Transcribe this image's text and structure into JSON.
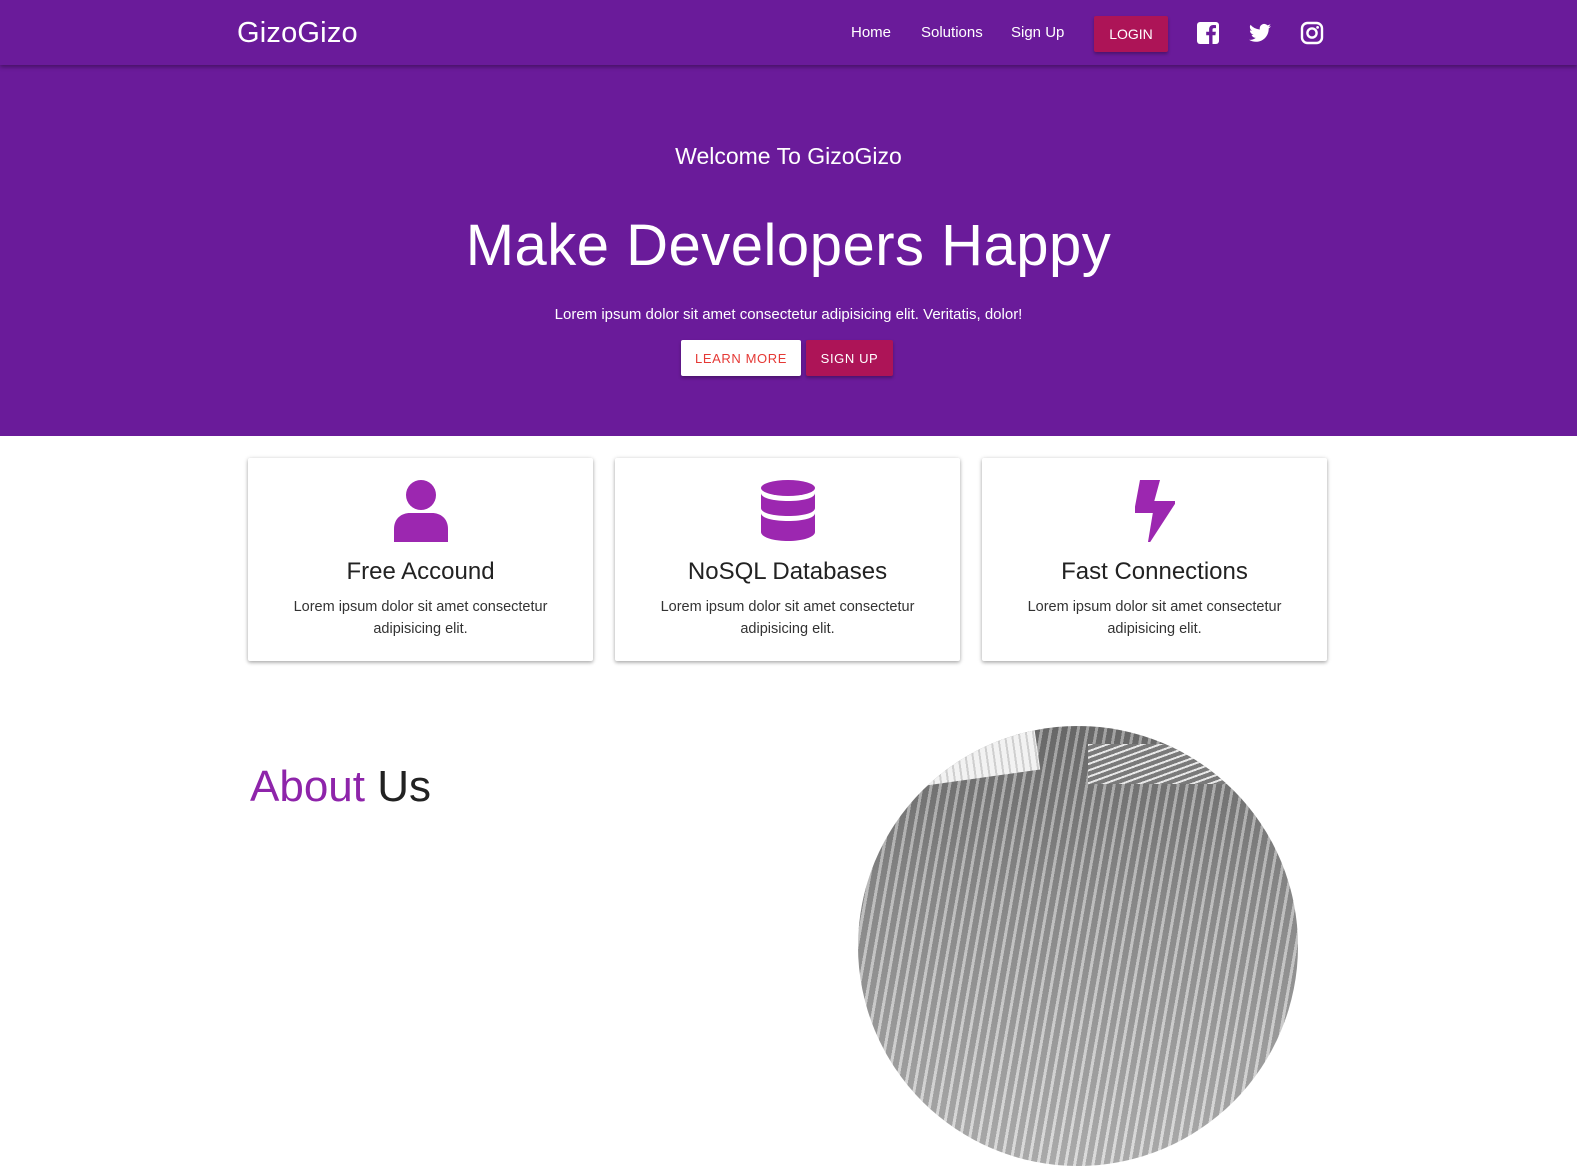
{
  "navbar": {
    "brand": "GizoGizo",
    "links": [
      {
        "label": "Home"
      },
      {
        "label": "Solutions"
      },
      {
        "label": "Sign Up"
      }
    ],
    "login_label": "LOGIN",
    "social_icons": [
      "facebook-icon",
      "twitter-icon",
      "instagram-icon"
    ],
    "background_color": "#6a1b9a",
    "accent_color": "#ad1457"
  },
  "hero": {
    "subtitle": "Welcome To GizoGizo",
    "title": "Make Developers Happy",
    "text": "Lorem ipsum dolor sit amet consectetur adipisicing elit. Veritatis, dolor!",
    "learn_more_label": "LEARN MORE",
    "sign_up_label": "SIGN UP",
    "learn_more_text_color": "#e53935"
  },
  "features": [
    {
      "icon": "user-icon",
      "title": "Free Accound",
      "text": "Lorem ipsum dolor sit amet consectetur adipisicing elit."
    },
    {
      "icon": "database-icon",
      "title": "NoSQL Databases",
      "text": "Lorem ipsum dolor sit amet consectetur adipisicing elit."
    },
    {
      "icon": "bolt-icon",
      "title": "Fast Connections",
      "text": "Lorem ipsum dolor sit amet consectetur adipisicing elit."
    }
  ],
  "feature_icon_color": "#9c27b0",
  "about": {
    "heading_part1": "About",
    "heading_part2": "Us"
  }
}
